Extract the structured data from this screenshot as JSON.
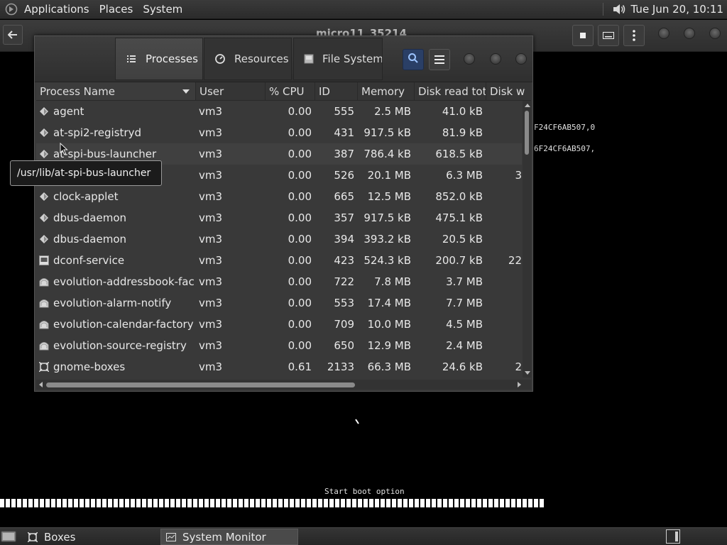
{
  "top_panel": {
    "menus": [
      "Applications",
      "Places",
      "System"
    ],
    "clock": "Tue Jun 20, 10:11"
  },
  "boxes": {
    "title": "micro11_35214"
  },
  "console": {
    "line1": "F24CF6AB507,0",
    "line2": "6F24CF6AB507,",
    "boot_text": "Start boot option"
  },
  "system_monitor": {
    "tabs": [
      {
        "label": "Processes",
        "icon": "list-icon"
      },
      {
        "label": "Resources",
        "icon": "gauge-icon"
      },
      {
        "label": "File Systems",
        "icon": "disk-icon"
      }
    ],
    "columns": [
      "Process Name",
      "User",
      "% CPU",
      "ID",
      "Memory",
      "Disk read total",
      "Disk w"
    ],
    "rows": [
      {
        "name": "agent",
        "user": "vm3",
        "cpu": "0.00",
        "id": "555",
        "memory": "2.5 MB",
        "disk_read": "41.0 kB",
        "disk_write": "",
        "icon": "diamond"
      },
      {
        "name": "at-spi2-registryd",
        "user": "vm3",
        "cpu": "0.00",
        "id": "431",
        "memory": "917.5 kB",
        "disk_read": "81.9 kB",
        "disk_write": "",
        "icon": "diamond"
      },
      {
        "name": "at-spi-bus-launcher",
        "user": "vm3",
        "cpu": "0.00",
        "id": "387",
        "memory": "786.4 kB",
        "disk_read": "618.5 kB",
        "disk_write": "",
        "icon": "diamond"
      },
      {
        "name": "",
        "user": "vm3",
        "cpu": "0.00",
        "id": "526",
        "memory": "20.1 MB",
        "disk_read": "6.3 MB",
        "disk_write": "3",
        "icon": "diamond"
      },
      {
        "name": "clock-applet",
        "user": "vm3",
        "cpu": "0.00",
        "id": "665",
        "memory": "12.5 MB",
        "disk_read": "852.0 kB",
        "disk_write": "",
        "icon": "diamond"
      },
      {
        "name": "dbus-daemon",
        "user": "vm3",
        "cpu": "0.00",
        "id": "357",
        "memory": "917.5 kB",
        "disk_read": "475.1 kB",
        "disk_write": "",
        "icon": "diamond"
      },
      {
        "name": "dbus-daemon",
        "user": "vm3",
        "cpu": "0.00",
        "id": "394",
        "memory": "393.2 kB",
        "disk_read": "20.5 kB",
        "disk_write": "",
        "icon": "diamond"
      },
      {
        "name": "dconf-service",
        "user": "vm3",
        "cpu": "0.00",
        "id": "423",
        "memory": "524.3 kB",
        "disk_read": "200.7 kB",
        "disk_write": "22",
        "icon": "dconf"
      },
      {
        "name": "evolution-addressbook-factory",
        "user": "vm3",
        "cpu": "0.00",
        "id": "722",
        "memory": "7.8 MB",
        "disk_read": "3.7 MB",
        "disk_write": "",
        "icon": "evolution"
      },
      {
        "name": "evolution-alarm-notify",
        "user": "vm3",
        "cpu": "0.00",
        "id": "553",
        "memory": "17.4 MB",
        "disk_read": "7.7 MB",
        "disk_write": "",
        "icon": "evolution"
      },
      {
        "name": "evolution-calendar-factory",
        "user": "vm3",
        "cpu": "0.00",
        "id": "709",
        "memory": "10.0 MB",
        "disk_read": "4.5 MB",
        "disk_write": "",
        "icon": "evolution"
      },
      {
        "name": "evolution-source-registry",
        "user": "vm3",
        "cpu": "0.00",
        "id": "650",
        "memory": "12.9 MB",
        "disk_read": "2.4 MB",
        "disk_write": "",
        "icon": "evolution"
      },
      {
        "name": "gnome-boxes",
        "user": "vm3",
        "cpu": "0.61",
        "id": "2133",
        "memory": "66.3 MB",
        "disk_read": "24.6 kB",
        "disk_write": "2",
        "icon": "boxes"
      }
    ],
    "tooltip": "/usr/lib/at-spi-bus-launcher"
  },
  "taskbar": {
    "items": [
      {
        "label": "Boxes",
        "icon": "boxes-icon"
      },
      {
        "label": "System Monitor",
        "icon": "monitor-icon"
      }
    ]
  }
}
